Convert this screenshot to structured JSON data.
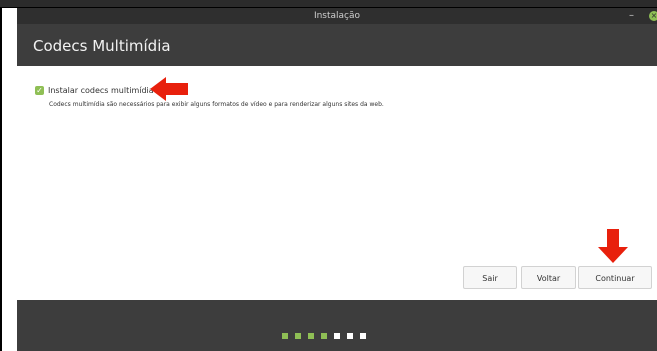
{
  "window": {
    "title": "Instalação",
    "minimize_glyph": "–",
    "close_glyph": "×"
  },
  "header": {
    "title": "Codecs Multimídia"
  },
  "option": {
    "checked": true,
    "label": "Instalar codecs multimídia",
    "description": "Codecs multimídia são necessários para exibir alguns formatos de vídeo e para renderizar alguns sites da web."
  },
  "buttons": {
    "quit": "Sair",
    "back": "Voltar",
    "continue": "Continuar"
  },
  "progress": {
    "total_steps": 7,
    "completed_steps": 4
  },
  "colors": {
    "accent": "#8fbf55",
    "header_bg": "#3d3d3d",
    "titlebar_bg": "#2f2f2f",
    "annotation_arrow": "#e8200c"
  }
}
